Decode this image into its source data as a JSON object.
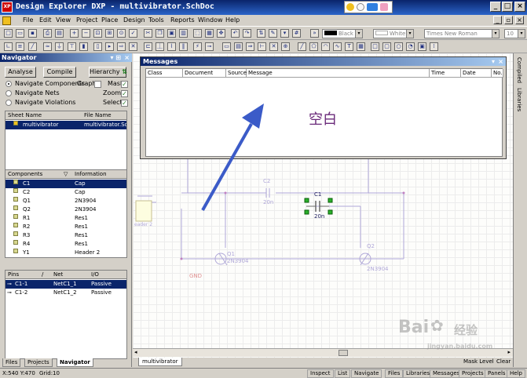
{
  "window": {
    "title": "Design Explorer DXP - multivibrator.SchDoc",
    "logo": "XP"
  },
  "menu": [
    "File",
    "Edit",
    "View",
    "Project",
    "Place",
    "Design",
    "Tools",
    "Reports",
    "Window",
    "Help"
  ],
  "toolbar": {
    "color1": "Black",
    "color2": "White",
    "font": "Times New Roman",
    "fontsize": "10"
  },
  "navigator": {
    "title": "Navigator",
    "analyse": "Analyse",
    "compile": "Compile",
    "hierarchy": "Hierarchy",
    "nav_components": "Navigate Components",
    "graph": "Graph",
    "mask": "Mask",
    "nav_nets": "Navigate Nets",
    "zoom": "Zoom",
    "nav_violations": "Navigate Violations",
    "select": "Select",
    "sheet_cols": [
      "Sheet Name",
      "File Name"
    ],
    "sheets": [
      {
        "name": "multivibrator",
        "file": "multivibrator.Sc..."
      }
    ],
    "comp_cols": [
      "Components",
      "Information"
    ],
    "components": [
      {
        "name": "C1",
        "info": "Cap"
      },
      {
        "name": "C2",
        "info": "Cap"
      },
      {
        "name": "Q1",
        "info": "2N3904"
      },
      {
        "name": "Q2",
        "info": "2N3904"
      },
      {
        "name": "R1",
        "info": "Res1"
      },
      {
        "name": "R2",
        "info": "Res1"
      },
      {
        "name": "R3",
        "info": "Res1"
      },
      {
        "name": "R4",
        "info": "Res1"
      },
      {
        "name": "Y1",
        "info": "Header 2"
      }
    ],
    "pin_cols": [
      "Pins",
      "Net",
      "I/O"
    ],
    "pins": [
      {
        "pin": "C1-1",
        "net": "NetC1_1",
        "io": "Passive"
      },
      {
        "pin": "C1-2",
        "net": "NetC1_2",
        "io": "Passive"
      }
    ]
  },
  "bottom_tabs": [
    "Files",
    "Projects",
    "Navigator"
  ],
  "messages": {
    "title": "Messages",
    "columns": [
      "Class",
      "Document",
      "Source",
      "Message",
      "Time",
      "Date",
      "No."
    ]
  },
  "annotation": "空白",
  "right_tabs": [
    "Compiled",
    "Libraries"
  ],
  "schematic": {
    "labels": [
      "C2",
      "20n",
      "C1",
      "20n",
      "Q1",
      "2N3904",
      "Q2",
      "2N3904",
      "GND",
      "eader 2"
    ]
  },
  "doc_tab": "multivibrator",
  "mask_level": "Mask Level",
  "clear": "Clear",
  "status": {
    "coords": "X:540 Y:470",
    "grid": "Grid:10",
    "buttons": [
      "Inspect",
      "List",
      "Navigate",
      "Files",
      "Libraries",
      "Messages",
      "Projects",
      "Panels",
      "Help"
    ]
  },
  "watermark": {
    "brand": "Bai",
    "brand2": "经验",
    "url": "jingyan.baidu.com"
  },
  "colors": {
    "title_bar": "#0a246a",
    "selection": "#0a246a",
    "annotation_arrow": "#3b5bc8"
  }
}
